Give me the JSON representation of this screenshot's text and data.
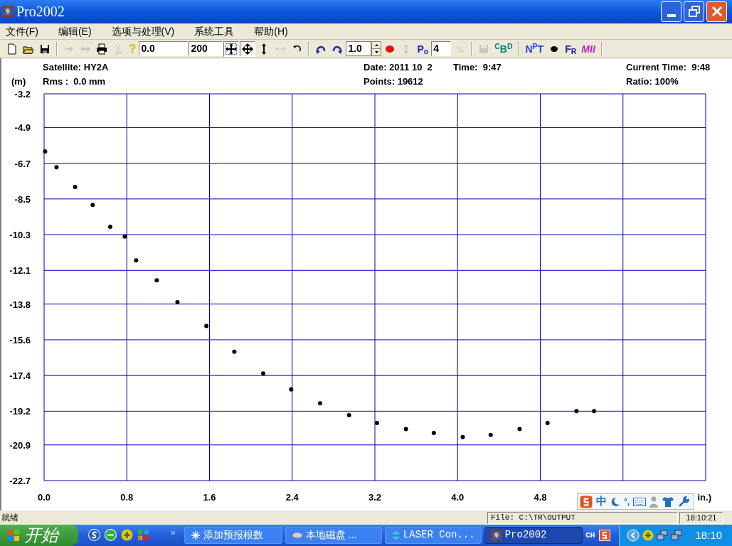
{
  "window": {
    "title": "Pro2002"
  },
  "menu": [
    "文件(F)",
    "编辑(E)",
    "选项与处理(V)",
    "系统工具",
    "帮助(H)"
  ],
  "toolbar": [
    {
      "kind": "button",
      "disabled": false,
      "pressed": false
    },
    {
      "kind": "button",
      "disabled": false,
      "pressed": false
    },
    {
      "kind": "button",
      "disabled": false,
      "pressed": false
    },
    {
      "kind": "separator"
    },
    {
      "kind": "button",
      "disabled": true,
      "pressed": false
    },
    {
      "kind": "button",
      "disabled": true,
      "pressed": false
    },
    {
      "kind": "button",
      "disabled": false,
      "pressed": false
    },
    {
      "kind": "button",
      "disabled": true,
      "pressed": false
    },
    {
      "kind": "text",
      "label": "?"
    },
    {
      "kind": "field",
      "value": "0.0"
    },
    {
      "kind": "field",
      "value": "200"
    },
    {
      "kind": "button",
      "disabled": false,
      "pressed": true
    },
    {
      "kind": "button",
      "disabled": false,
      "pressed": true
    },
    {
      "kind": "button",
      "disabled": false,
      "pressed": false
    },
    {
      "kind": "button",
      "disabled": true,
      "pressed": false
    },
    {
      "kind": "button",
      "disabled": false,
      "pressed": false
    },
    {
      "kind": "separator"
    },
    {
      "kind": "button",
      "disabled": false,
      "pressed": false
    },
    {
      "kind": "button",
      "disabled": false,
      "pressed": false
    },
    {
      "kind": "spin",
      "value": "1.0"
    },
    {
      "kind": "button",
      "disabled": false,
      "pressed": false
    },
    {
      "kind": "button",
      "disabled": true,
      "pressed": false
    },
    {
      "kind": "text",
      "label": "P$_{o}$"
    },
    {
      "kind": "field",
      "value": "4"
    },
    {
      "kind": "button",
      "disabled": true,
      "pressed": false
    },
    {
      "kind": "separator"
    },
    {
      "kind": "button",
      "disabled": true,
      "pressed": false
    },
    {
      "kind": "text",
      "label": "$^{C}$B$^{D}$"
    },
    {
      "kind": "separator"
    },
    {
      "kind": "text",
      "label": "N$^{P}$T"
    },
    {
      "kind": "button",
      "disabled": false,
      "pressed": false
    },
    {
      "kind": "text",
      "label": "F$_{R}$"
    },
    {
      "kind": "text",
      "label": "MII"
    },
    {
      "kind": "separator"
    }
  ],
  "info": {
    "satellite": "Satellite: HY2A",
    "rms": "Rms :  0.0 mm",
    "date": "Date: 2011 10  2",
    "time": "Time:  9:47",
    "points": "Points: 19612",
    "current_time": "Current Time:  9:48",
    "ratio": "Ratio: 100%"
  },
  "chart": {
    "unit": "(m)",
    "axis_tail": "in.)",
    "chart_data": {
      "type": "scatter",
      "grid": true,
      "xlim": [
        0,
        6.4
      ],
      "ylim": [
        -22.7,
        -3.2
      ],
      "xticks": [
        {
          "value": 0,
          "label": "0.0"
        },
        {
          "value": 0.8,
          "label": "0.8"
        },
        {
          "value": 1.6,
          "label": "1.6"
        },
        {
          "value": 2.4,
          "label": "2.4"
        },
        {
          "value": 3.2,
          "label": "3.2"
        },
        {
          "value": 4.0,
          "label": "4.0"
        },
        {
          "value": 4.8,
          "label": "4.8"
        }
      ],
      "yticks": [
        -3.2,
        -4.9,
        -6.7,
        -8.5,
        -10.3,
        -12.1,
        -13.8,
        -15.6,
        -17.4,
        -19.2,
        -20.9,
        -22.7
      ],
      "x": [
        0.01,
        0.12,
        0.3,
        0.47,
        0.64,
        0.78,
        0.89,
        1.09,
        1.29,
        1.57,
        1.84,
        2.12,
        2.39,
        2.67,
        2.95,
        3.22,
        3.5,
        3.77,
        4.05,
        4.32,
        4.6,
        4.87,
        5.15,
        5.32
      ],
      "series": [
        {
          "color": "#000000",
          "values": [
            -6.1,
            -6.9,
            -7.9,
            -8.8,
            -9.9,
            -10.4,
            -11.6,
            -12.6,
            -13.7,
            -14.9,
            -16.2,
            -17.3,
            -18.1,
            -18.8,
            -19.4,
            -19.8,
            -20.1,
            -20.3,
            -20.5,
            -20.4,
            -20.1,
            -19.8,
            -19.2,
            -19.2
          ]
        }
      ]
    }
  },
  "ime": {
    "mode": "中",
    "punct": "°,"
  },
  "status_bar": {
    "message": "就绪",
    "file": "File: C:\\TR\\OUTPUT",
    "clock": "18:10:21"
  },
  "taskbar": {
    "start": "开始",
    "more": "»",
    "tasks": [
      {
        "label": "添加预报根数",
        "selected": false
      },
      {
        "label": "本地磁盘 ...",
        "selected": false
      },
      {
        "label": "LASER Con...",
        "selected": false
      },
      {
        "label": "Pro2002",
        "selected": true
      }
    ],
    "language": "CH",
    "clock": "18:10"
  }
}
